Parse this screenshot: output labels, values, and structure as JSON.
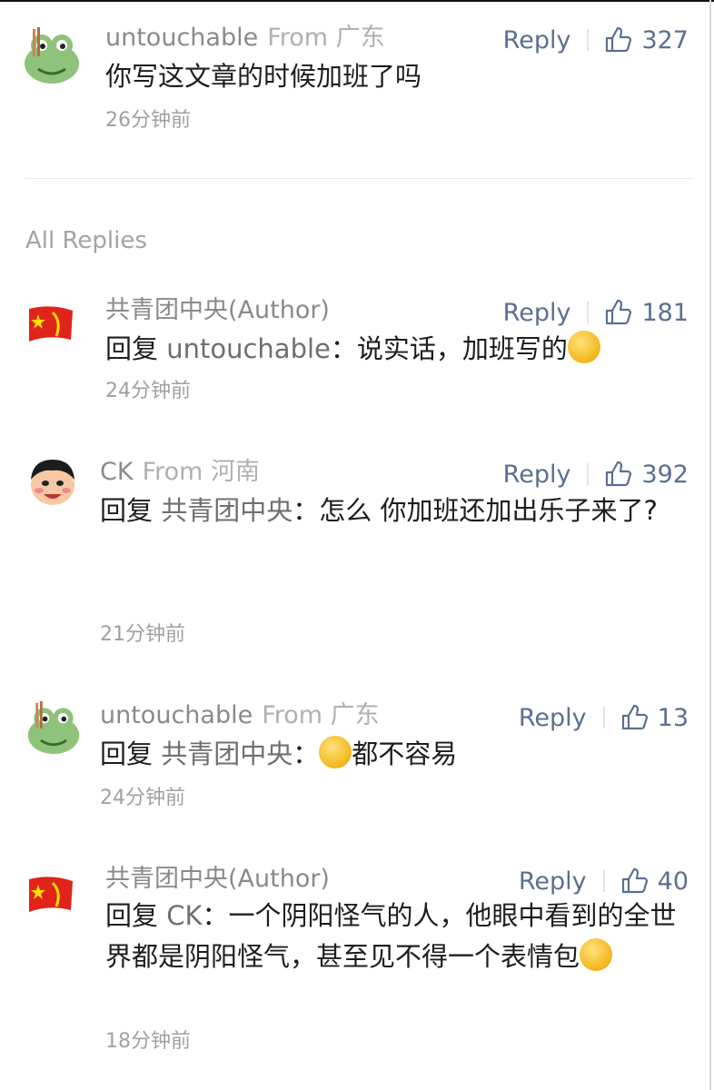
{
  "top_comment": {
    "author": "untouchable",
    "from": "From 广东",
    "reply_label": "Reply",
    "likes": "327",
    "text": "你写这文章的时候加班了吗",
    "time": "26分钟前"
  },
  "section_title": "All Replies",
  "replies": [
    {
      "author": "共青团中央(Author)",
      "from": "",
      "reply_label": "Reply",
      "likes": "181",
      "prefix": "回复 ",
      "mention": "untouchable",
      "body": "：说实话，加班写的",
      "emoji": "thinking-face",
      "time": "24分钟前"
    },
    {
      "author": "CK",
      "from": "From 河南",
      "reply_label": "Reply",
      "likes": "392",
      "prefix": "回复 ",
      "mention": "共青团中央",
      "body": "：怎么 你加班还加出乐子来了?",
      "time": "21分钟前"
    },
    {
      "author": "untouchable",
      "from": "From 广东",
      "reply_label": "Reply",
      "likes": "13",
      "prefix": "回复 ",
      "mention": "共青团中央",
      "body_before": "：",
      "emoji": "sigh-face",
      "body": "都不容易",
      "time": "24分钟前"
    },
    {
      "author": "共青团中央(Author)",
      "from": "",
      "reply_label": "Reply",
      "likes": "40",
      "prefix": "回复 ",
      "mention": "CK",
      "body": "：一个阴阳怪气的人，他眼中看到的全世界都是阴阳怪气，甚至见不得一个表情包",
      "emoji": "thinking-face",
      "time": "18分钟前"
    }
  ],
  "colors": {
    "link_blue": "#5b6f8f",
    "meta_gray": "#8a8a8a",
    "author_red": "#e0241a"
  }
}
